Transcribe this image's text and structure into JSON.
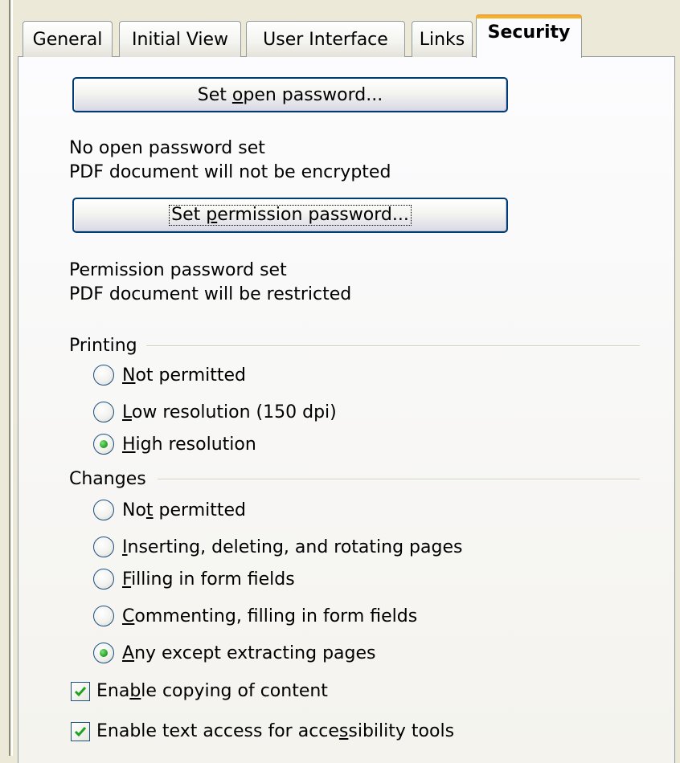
{
  "tabs": [
    {
      "label": "General",
      "active": false
    },
    {
      "label": "Initial View",
      "active": false
    },
    {
      "label": "User Interface",
      "active": false
    },
    {
      "label": "Links",
      "active": false
    },
    {
      "label": "Security",
      "active": true
    }
  ],
  "open_password": {
    "button_pre": "Set ",
    "button_ul": "o",
    "button_post": "pen password...",
    "status_line1": "No open password set",
    "status_line2": "PDF document will not be encrypted"
  },
  "permission_password": {
    "button_pre": "Set ",
    "button_ul": "p",
    "button_post": "ermission password...",
    "status_line1": "Permission password set",
    "status_line2": "PDF document will be restricted"
  },
  "printing": {
    "label": "Printing",
    "options": [
      {
        "pre": "",
        "ul": "N",
        "post": "ot permitted",
        "checked": false
      },
      {
        "pre": "",
        "ul": "L",
        "post": "ow resolution (150 dpi)",
        "checked": false
      },
      {
        "pre": "",
        "ul": "H",
        "post": "igh resolution",
        "checked": true
      }
    ]
  },
  "changes": {
    "label": "Changes",
    "options": [
      {
        "pre": "No",
        "ul": "t",
        "post": " permitted",
        "checked": false
      },
      {
        "pre": "",
        "ul": "I",
        "post": "nserting, deleting, and rotating pages",
        "checked": false
      },
      {
        "pre": "",
        "ul": "F",
        "post": "illing in form fields",
        "checked": false
      },
      {
        "pre": "",
        "ul": "C",
        "post": "ommenting, filling in form fields",
        "checked": false
      },
      {
        "pre": "",
        "ul": "A",
        "post": "ny except extracting pages",
        "checked": true
      }
    ]
  },
  "content": {
    "checkboxes": [
      {
        "pre": "Ena",
        "ul": "b",
        "post": "le copying of content",
        "checked": true
      },
      {
        "pre": "Enable text access for acce",
        "ul": "s",
        "post": "sibility tools",
        "checked": true
      }
    ]
  },
  "colors": {
    "dialog_bg": "#ece9d8",
    "tab_highlight": "#f3b12e",
    "control_border": "#1c5180",
    "radio_dot": "#31a52c",
    "check_mark": "#21a121"
  }
}
